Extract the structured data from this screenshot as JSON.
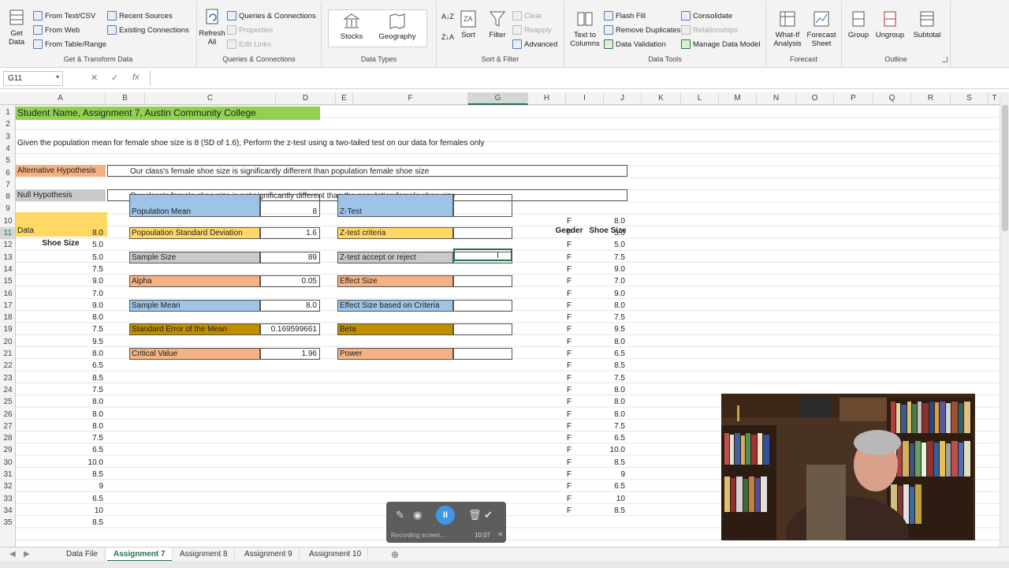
{
  "ribbon": {
    "get_transform": {
      "get_data": "Get Data",
      "from_text_csv": "From Text/CSV",
      "from_web": "From Web",
      "from_table_range": "From Table/Range",
      "recent_sources": "Recent Sources",
      "existing_connections": "Existing Connections",
      "title": "Get & Transform Data"
    },
    "queries": {
      "refresh_all": "Refresh All",
      "queries_connections": "Queries & Connections",
      "properties": "Properties",
      "edit_links": "Edit Links",
      "title": "Queries & Connections"
    },
    "data_types": {
      "stocks": "Stocks",
      "geography": "Geography",
      "title": "Data Types"
    },
    "sort_filter": {
      "sort": "Sort",
      "filter": "Filter",
      "clear": "Clear",
      "reapply": "Reapply",
      "advanced": "Advanced",
      "title": "Sort & Filter"
    },
    "data_tools": {
      "text_to_columns": "Text to Columns",
      "flash_fill": "Flash Fill",
      "remove_duplicates": "Remove Duplicates",
      "data_validation": "Data Validation",
      "consolidate": "Consolidate",
      "relationships": "Relationships",
      "manage_data_model": "Manage Data Model",
      "title": "Data Tools"
    },
    "forecast": {
      "what_if": "What-If Analysis",
      "forecast_sheet": "Forecast Sheet",
      "title": "Forecast"
    },
    "outline": {
      "group": "Group",
      "ungroup": "Ungroup",
      "subtotal": "Subtotal",
      "title": "Outline"
    }
  },
  "formula_bar": {
    "name_box": "G11",
    "cancel": "✕",
    "enter": "✓",
    "fx": "fx",
    "formula": ""
  },
  "columns": [
    "A",
    "B",
    "C",
    "D",
    "E",
    "F",
    "G",
    "H",
    "I",
    "J",
    "K",
    "L",
    "M",
    "N",
    "O",
    "P",
    "Q",
    "R",
    "S",
    "T"
  ],
  "rows": [
    "1",
    "2",
    "3",
    "4",
    "5",
    "6",
    "7",
    "8",
    "9",
    "10",
    "11",
    "12",
    "13",
    "14",
    "15",
    "16",
    "17",
    "18",
    "19",
    "20",
    "21",
    "22",
    "23",
    "24",
    "25",
    "26",
    "27",
    "28",
    "29",
    "30",
    "31",
    "32",
    "33",
    "34",
    "35"
  ],
  "sheet": {
    "title": "Student Name, Assignment 7, Austin Community College",
    "instruction": "Given the population mean for female shoe size is 8 (SD of 1.6), Perform the z-test using a two-tailed test on our data for females only",
    "alt_hyp_label": "Alternative Hypothesis",
    "alt_hyp_text": "Our class's female shoe size is significantly different than population female shoe size",
    "null_hyp_label": "Null Hypothesis",
    "null_hyp_text": "Our class's female shoe size is not significantly different than the population female shoe size",
    "data_label": "Data",
    "shoe_size_header": "Shoe Size",
    "data_values": [
      "8.0",
      "5.0",
      "5.0",
      "7.5",
      "9.0",
      "7.0",
      "9.0",
      "8.0",
      "7.5",
      "9.5",
      "8.0",
      "6.5",
      "8.5",
      "7.5",
      "8.0",
      "8.0",
      "8.0",
      "7.5",
      "6.5",
      "10.0",
      "8.5",
      "9",
      "6.5",
      "10",
      "8.5"
    ],
    "stats": [
      {
        "label": "Population Mean",
        "value": "8"
      },
      {
        "label": "Popoulation Standard Deviation",
        "value": "1.6"
      },
      {
        "label": "Sample Size",
        "value": "89"
      },
      {
        "label": "Alpha",
        "value": "0.05"
      },
      {
        "label": "Sample Mean",
        "value": "8.0"
      },
      {
        "label": "Standard Error of the Mean",
        "value": "0.169599661"
      },
      {
        "label": "Critical Value",
        "value": "1.96"
      }
    ],
    "tests": [
      {
        "label": "Z-Test",
        "value": ""
      },
      {
        "label": "Z-test criteria",
        "value": ""
      },
      {
        "label": "Z-test accept or reject",
        "value": ""
      },
      {
        "label": "Effect Size",
        "value": ""
      },
      {
        "label": "Effect Size based on Criteria",
        "value": ""
      },
      {
        "label": "Beta",
        "value": ""
      },
      {
        "label": "Power",
        "value": ""
      }
    ],
    "gender_header": "Gender",
    "shoe_header2": "Shoe Size",
    "gender_values": [
      "F",
      "F",
      "F",
      "F",
      "F",
      "F",
      "F",
      "F",
      "F",
      "F",
      "F",
      "F",
      "F",
      "F",
      "F",
      "F",
      "F",
      "F",
      "F",
      "F",
      "F",
      "F",
      "F",
      "F",
      "F"
    ],
    "shoe_values2": [
      "8.0",
      "5.0",
      "5.0",
      "7.5",
      "9.0",
      "7.0",
      "9.0",
      "8.0",
      "7.5",
      "9.5",
      "8.0",
      "6.5",
      "8.5",
      "7.5",
      "8.0",
      "8.0",
      "8.0",
      "7.5",
      "6.5",
      "10.0",
      "8.5",
      "9",
      "6.5",
      "10",
      "8.5"
    ]
  },
  "tabs": [
    "Data File",
    "Assignment 7",
    "Assignment 8",
    "Assignment 9",
    "Assignment 10"
  ],
  "active_tab": "Assignment 7",
  "recorder": {
    "status": "Recording screen...",
    "time": "10:07"
  },
  "colors": {
    "green_header": "#92d050",
    "orange": "#f4b183",
    "gray": "#c9c9c9",
    "blue": "#9dc3e6",
    "yellow": "#ffd966",
    "gold": "#bf8f00",
    "excel_green": "#217346"
  }
}
